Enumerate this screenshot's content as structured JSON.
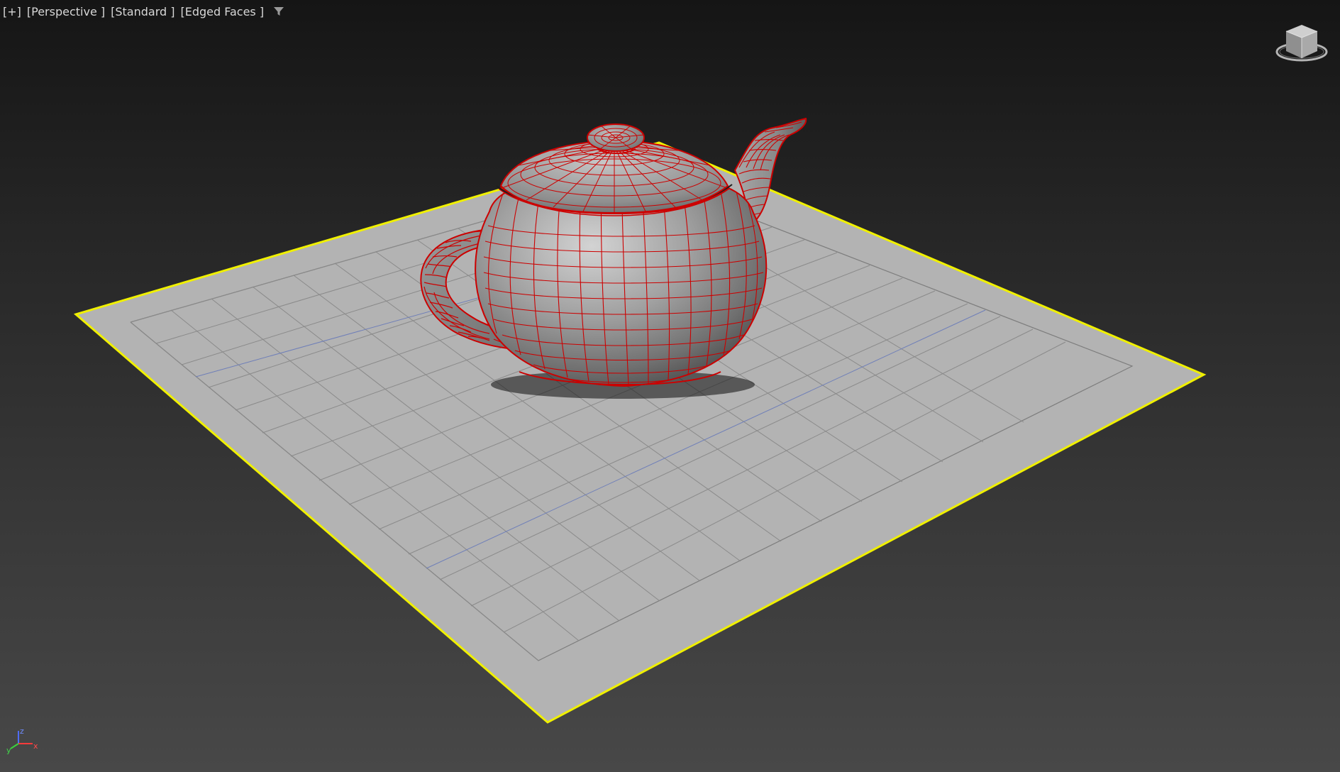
{
  "viewport": {
    "labels": {
      "plus": "[+]",
      "view": "[Perspective ]",
      "shading": "[Standard ]",
      "display": "[Edged Faces ]"
    },
    "filter_icon": "viewport-filter-icon"
  },
  "gizmo": {
    "axes": {
      "x": "x",
      "y": "y",
      "z": "z"
    }
  },
  "scene": {
    "objects": [
      "plane",
      "teapot"
    ],
    "selected": "plane",
    "plane_color": "#b3b3b3",
    "selection_color": "#ffff00",
    "wire_color": "#cc0000",
    "teapot_color": "#8a8a8a"
  },
  "colors": {
    "background_top": "#151515",
    "background_bottom": "#484848",
    "label_text": "#d7d7d7",
    "axis_x": "#ff3b3b",
    "axis_y": "#3bd23b",
    "axis_z": "#4f6cff"
  }
}
